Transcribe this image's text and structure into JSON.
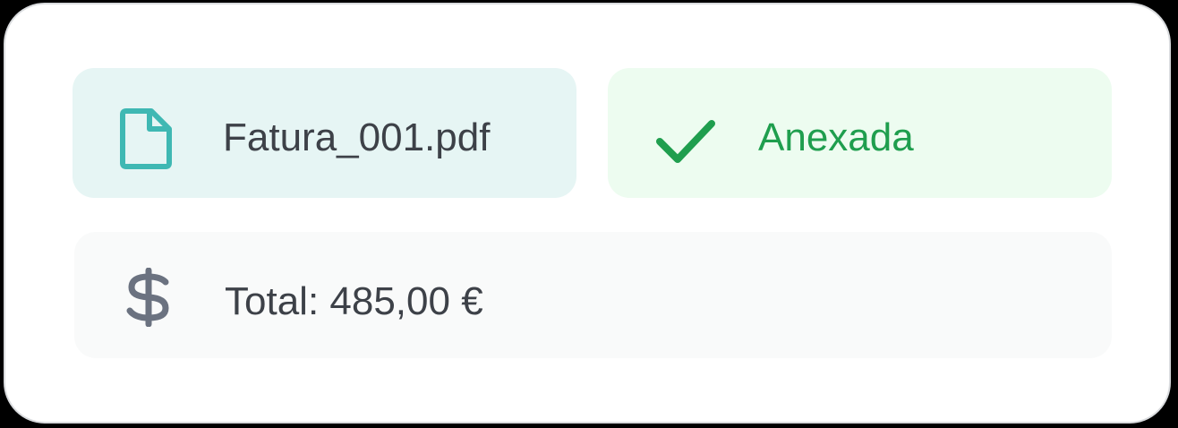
{
  "attachment": {
    "file_name": "Fatura_001.pdf",
    "file_icon": "file-icon",
    "status_label": "Anexada",
    "status_icon": "checkmark-icon",
    "total_label": "Total: 485,00 €",
    "total_icon": "dollar-icon"
  },
  "colors": {
    "file_accent": "#3fb8b3",
    "status_accent": "#1f9e4e",
    "total_icon": "#6b7280",
    "text": "#3d4148"
  }
}
